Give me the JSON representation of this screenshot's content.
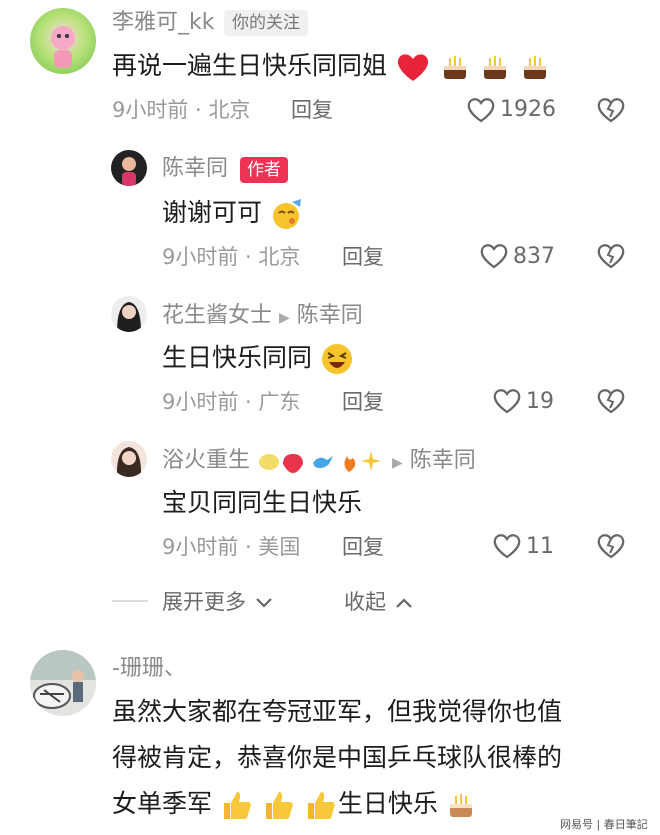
{
  "comment1": {
    "username": "李雅可_kk",
    "follow_tag": "你的关注",
    "text": "再说一遍生日快乐同同姐",
    "time_location": "9小时前 · 北京",
    "reply_label": "回复",
    "likes": "1926"
  },
  "reply1": {
    "username": "陈幸同",
    "author_tag": "作者",
    "text": "谢谢可可",
    "time_location": "9小时前 · 北京",
    "reply_label": "回复",
    "likes": "837"
  },
  "reply2": {
    "username": "花生酱女士",
    "reply_to": "陈幸同",
    "text": "生日快乐同同",
    "time_location": "9小时前 · 广东",
    "reply_label": "回复",
    "likes": "19"
  },
  "reply3": {
    "username": "浴火重生",
    "reply_to": "陈幸同",
    "text": "宝贝同同生日快乐",
    "time_location": "9小时前 · 美国",
    "reply_label": "回复",
    "likes": "11"
  },
  "thread_controls": {
    "expand_label": "展开更多",
    "collapse_label": "收起"
  },
  "comment2": {
    "username": "-珊珊、",
    "line1": "虽然大家都在夸冠亚军，但我觉得你也值",
    "line2": "得被肯定，恭喜你是中国乒乓球队很棒的",
    "line3": "女单季军",
    "line3_tail": "生日快乐"
  },
  "watermark": "网易号 | 春日筆記",
  "colors": {
    "author_tag": "#ee3355",
    "heart_red": "#e8233a",
    "text_gray": "#9a9a9a"
  }
}
